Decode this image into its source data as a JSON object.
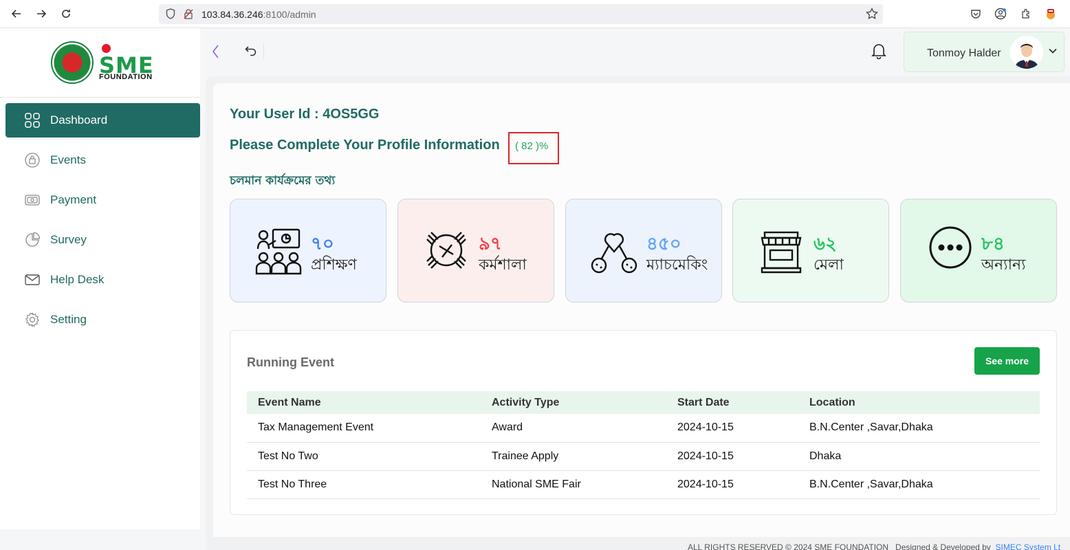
{
  "browser": {
    "url_host": "103.84.36.246",
    "url_path": ":8100/admin"
  },
  "brand": {
    "logo_text": "SME",
    "logo_sub": "FOUNDATION"
  },
  "sidebar": {
    "items": [
      {
        "label": "Dashboard",
        "icon": "dashboard-grid-icon",
        "active": true
      },
      {
        "label": "Events",
        "icon": "events-icon"
      },
      {
        "label": "Payment",
        "icon": "payment-icon"
      },
      {
        "label": "Survey",
        "icon": "pie-chart-icon"
      },
      {
        "label": "Help Desk",
        "icon": "mail-icon"
      },
      {
        "label": "Setting",
        "icon": "gear-icon"
      }
    ]
  },
  "header": {
    "user_name": "Tonmoy Halder"
  },
  "main": {
    "user_id_text": "Your User Id : 4OS5GG",
    "complete_text": "Please Complete Your Profile Information",
    "profile_percent": "( 82 )%",
    "section_title": "চলমান কার্যক্রমের তথ্য",
    "stats": [
      {
        "number": "৭০",
        "label": "প্রশিক্ষণ",
        "icon": "training-icon",
        "num_color": "#3b82f6",
        "bg": "#eef4ff"
      },
      {
        "number": "৯৭",
        "label": "কর্মশালা",
        "icon": "workshop-icon",
        "num_color": "#ef4444",
        "bg": "#fdeeee"
      },
      {
        "number": "৪৫০",
        "label": "ম্যাচমেকিং",
        "icon": "matchmaking-icon",
        "num_color": "#60a5fa",
        "bg": "#edf3fd"
      },
      {
        "number": "৬২",
        "label": "মেলা",
        "icon": "store-icon",
        "num_color": "#22c55e",
        "bg": "#edfaf1"
      },
      {
        "number": "৮৪",
        "label": "অন্যান্য",
        "icon": "more-dots-icon",
        "num_color": "#22c55e",
        "bg": "#e2f8e9"
      }
    ]
  },
  "events": {
    "title": "Running Event",
    "see_more": "See more",
    "columns": [
      "Event Name",
      "Activity Type",
      "Start Date",
      "Location"
    ],
    "rows": [
      [
        "Tax Management Event",
        "Award",
        "2024-10-15",
        "B.N.Center ,Savar,Dhaka"
      ],
      [
        "Test No Two",
        "Trainee Apply",
        "2024-10-15",
        "Dhaka"
      ],
      [
        "Test No Three",
        "National SME Fair",
        "2024-10-15",
        "B.N.Center ,Savar,Dhaka"
      ]
    ]
  },
  "footer": {
    "copyright": "ALL RIGHTS RESERVED © 2024 SME FOUNDATION",
    "designed_by": "Designed & Developed by",
    "developer": "SIMEC System Lt"
  }
}
